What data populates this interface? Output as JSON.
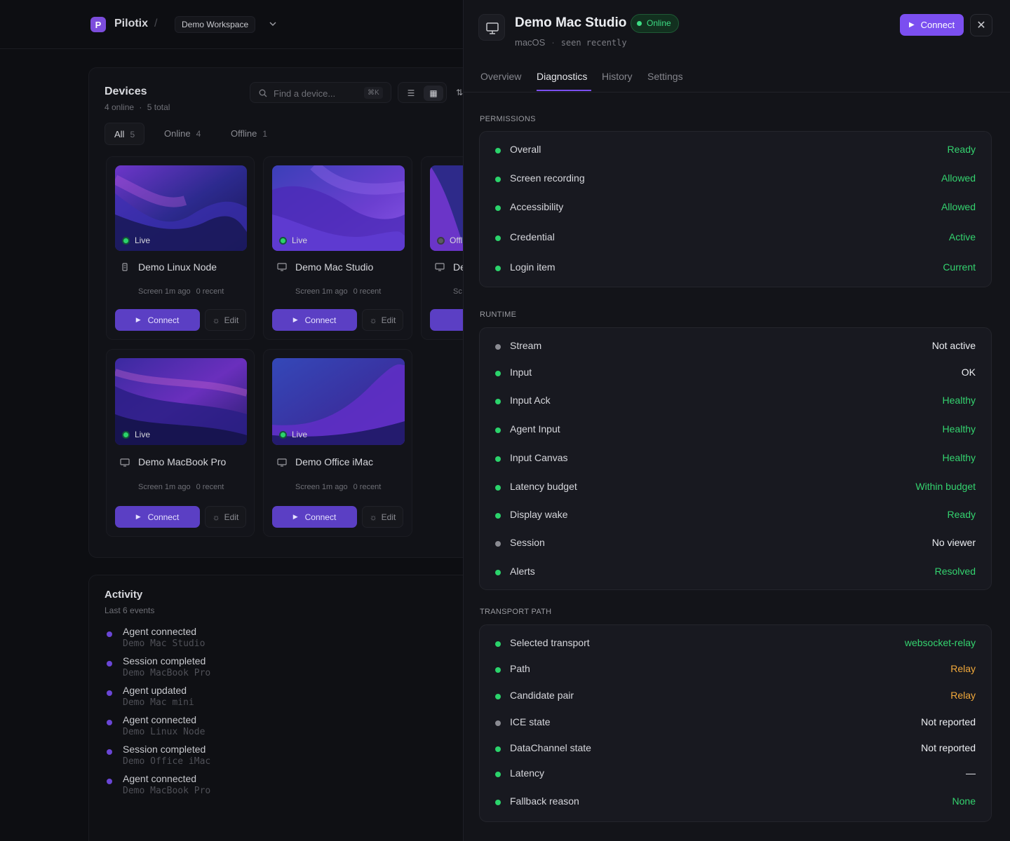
{
  "app": {
    "brand": "Pilotix",
    "logo_letter": "P",
    "crumb_sep": "/",
    "workspace": "Demo Workspace"
  },
  "devices": {
    "title": "Devices",
    "online_count": "4 online",
    "total": "5 total",
    "sep": "·",
    "search_placeholder": "Find a device...",
    "search_kbd": "⌘K",
    "filters": [
      {
        "label": "All",
        "count": "5"
      },
      {
        "label": "Online",
        "count": "4"
      },
      {
        "label": "Offline",
        "count": "1"
      }
    ],
    "cards": [
      {
        "name": "Demo Linux Node",
        "status": "Live",
        "screen": "Screen 1m ago",
        "recent": "0 recent",
        "connect": "Connect",
        "edit": "Edit"
      },
      {
        "name": "Demo Mac Studio",
        "status": "Live",
        "screen": "Screen 1m ago",
        "recent": "0 recent",
        "connect": "Connect",
        "edit": "Edit"
      },
      {
        "name": "De",
        "status": "Offl",
        "screen": "Sc",
        "recent": "",
        "connect": "",
        "edit": ""
      },
      {
        "name": "Demo MacBook Pro",
        "status": "Live",
        "screen": "Screen 1m ago",
        "recent": "0 recent",
        "connect": "Connect",
        "edit": "Edit"
      },
      {
        "name": "Demo Office iMac",
        "status": "Live",
        "screen": "Screen 1m ago",
        "recent": "0 recent",
        "connect": "Connect",
        "edit": "Edit"
      }
    ]
  },
  "activity": {
    "title": "Activity",
    "subtitle": "Last 6 events",
    "events": [
      {
        "title": "Agent connected",
        "device": "Demo Mac Studio"
      },
      {
        "title": "Session completed",
        "device": "Demo MacBook Pro"
      },
      {
        "title": "Agent updated",
        "device": "Demo Mac mini"
      },
      {
        "title": "Agent connected",
        "device": "Demo Linux Node"
      },
      {
        "title": "Session completed",
        "device": "Demo Office iMac"
      },
      {
        "title": "Agent connected",
        "device": "Demo MacBook Pro"
      }
    ]
  },
  "detail": {
    "title": "Demo Mac Studio",
    "badge": "Online",
    "os": "macOS",
    "sep": "·",
    "seen": "seen recently",
    "connect": "Connect",
    "close": "✕",
    "tabs": [
      "Overview",
      "Diagnostics",
      "History",
      "Settings"
    ],
    "active_tab": "Diagnostics",
    "sections": {
      "permissions": {
        "label": "PERMISSIONS",
        "rows": [
          {
            "label": "Overall",
            "value": "Ready",
            "tone": "green"
          },
          {
            "label": "Screen recording",
            "value": "Allowed",
            "tone": "green"
          },
          {
            "label": "Accessibility",
            "value": "Allowed",
            "tone": "green"
          },
          {
            "label": "Credential",
            "value": "Active",
            "tone": "green"
          },
          {
            "label": "Login item",
            "value": "Current",
            "tone": "green"
          }
        ]
      },
      "runtime": {
        "label": "RUNTIME",
        "rows": [
          {
            "label": "Stream",
            "value": "Not active",
            "tone": "gray"
          },
          {
            "label": "Input",
            "value": "OK",
            "tone": "green-white"
          },
          {
            "label": "Input Ack",
            "value": "Healthy",
            "tone": "green"
          },
          {
            "label": "Agent Input",
            "value": "Healthy",
            "tone": "green"
          },
          {
            "label": "Input Canvas",
            "value": "Healthy",
            "tone": "green"
          },
          {
            "label": "Latency budget",
            "value": "Within budget",
            "tone": "green"
          },
          {
            "label": "Display wake",
            "value": "Ready",
            "tone": "green"
          },
          {
            "label": "Session",
            "value": "No viewer",
            "tone": "gray"
          },
          {
            "label": "Alerts",
            "value": "Resolved",
            "tone": "green"
          }
        ]
      },
      "transport": {
        "label": "TRANSPORT PATH",
        "rows": [
          {
            "label": "Selected transport",
            "value": "websocket-relay",
            "tone": "green"
          },
          {
            "label": "Path",
            "value": "Relay",
            "tone": "orange"
          },
          {
            "label": "Candidate pair",
            "value": "Relay",
            "tone": "orange"
          },
          {
            "label": "ICE state",
            "value": "Not reported",
            "tone": "gray"
          },
          {
            "label": "DataChannel state",
            "value": "Not reported",
            "tone": "green-white"
          },
          {
            "label": "Latency",
            "value": "—",
            "tone": "green-white"
          },
          {
            "label": "Fallback reason",
            "value": "None",
            "tone": "green"
          }
        ]
      }
    }
  },
  "colors": {
    "accent": "#7b4ff0",
    "ok": "#34d36f",
    "warn": "#f2a93b",
    "bg": "#0d0e12"
  }
}
